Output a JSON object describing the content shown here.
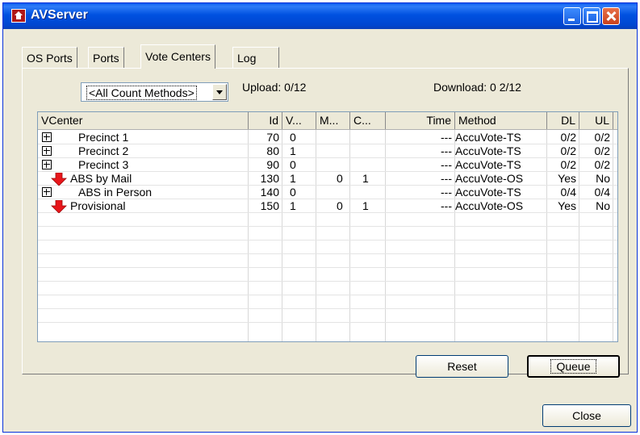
{
  "window": {
    "title": "AVServer"
  },
  "tabs": [
    {
      "label": "OS Ports"
    },
    {
      "label": "Ports"
    },
    {
      "label": "Vote Centers",
      "active": true
    },
    {
      "label": "Log"
    }
  ],
  "filter": {
    "selected": "<All Count Methods>"
  },
  "upload": {
    "label": "Upload:",
    "value": "0/12"
  },
  "download": {
    "label": "Download:",
    "value": "0 2/12"
  },
  "table": {
    "columns": [
      "VCenter",
      "Id",
      "V...",
      "M...",
      "C...",
      "Time",
      "Method",
      "DL",
      "UL"
    ],
    "rows": [
      {
        "icon": "expand-icon",
        "name": "Precinct 1",
        "id": "70",
        "v": "0",
        "m": "",
        "c": "",
        "time": "---",
        "method": "AccuVote-TS",
        "dl": "0/2",
        "ul": "0/2"
      },
      {
        "icon": "expand-icon",
        "name": "Precinct 2",
        "id": "80",
        "v": "1",
        "m": "",
        "c": "",
        "time": "---",
        "method": "AccuVote-TS",
        "dl": "0/2",
        "ul": "0/2"
      },
      {
        "icon": "expand-icon",
        "name": "Precinct 3",
        "id": "90",
        "v": "0",
        "m": "",
        "c": "",
        "time": "---",
        "method": "AccuVote-TS",
        "dl": "0/2",
        "ul": "0/2"
      },
      {
        "icon": "red-down-arrow-icon",
        "name": "ABS by Mail",
        "id": "130",
        "v": "1",
        "m": "0",
        "c": "1",
        "time": "---",
        "method": "AccuVote-OS",
        "dl": "Yes",
        "ul": "No"
      },
      {
        "icon": "expand-icon",
        "name": "ABS in Person",
        "id": "140",
        "v": "0",
        "m": "",
        "c": "",
        "time": "---",
        "method": "AccuVote-TS",
        "dl": "0/4",
        "ul": "0/4"
      },
      {
        "icon": "red-down-arrow-icon",
        "name": "Provisional",
        "id": "150",
        "v": "1",
        "m": "0",
        "c": "1",
        "time": "---",
        "method": "AccuVote-OS",
        "dl": "Yes",
        "ul": "No"
      }
    ]
  },
  "buttons": {
    "reset": "Reset",
    "queue": "Queue",
    "close": "Close"
  },
  "colors": {
    "titlebar": "#0051e0",
    "arrow": "#e8161b",
    "face": "#ece9d8"
  }
}
